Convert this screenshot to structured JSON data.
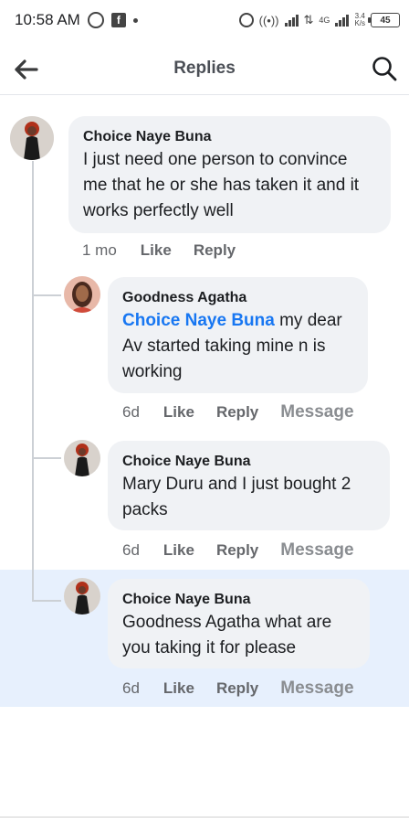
{
  "status_bar": {
    "time": "10:58 AM",
    "network_type": "4G",
    "speed_value": "3.4",
    "speed_unit": "K/s",
    "battery": "45"
  },
  "header": {
    "title": "Replies",
    "back_icon": "arrow-left-icon",
    "search_icon": "search-icon"
  },
  "comments": [
    {
      "author": "Choice Naye Buna",
      "text": "I just need one person to convince me that he or she has taken it and it works perfectly well",
      "time": "1 mo",
      "like": "Like",
      "reply": "Reply"
    },
    {
      "author": "Goodness Agatha",
      "mention": "Choice Naye Buna",
      "text": " my dear Av started taking mine n is working",
      "time": "6d",
      "like": "Like",
      "reply": "Reply",
      "message": "Message"
    },
    {
      "author": "Choice Naye Buna",
      "text": "Mary Duru and I just bought 2 packs",
      "time": "6d",
      "like": "Like",
      "reply": "Reply",
      "message": "Message"
    },
    {
      "author": "Choice Naye Buna",
      "text": "Goodness Agatha what are you taking it for please",
      "time": "6d",
      "like": "Like",
      "reply": "Reply",
      "message": "Message"
    }
  ],
  "colors": {
    "mention": "#1877f2",
    "bubble": "#f0f2f5",
    "highlight": "#e7f0fd"
  }
}
